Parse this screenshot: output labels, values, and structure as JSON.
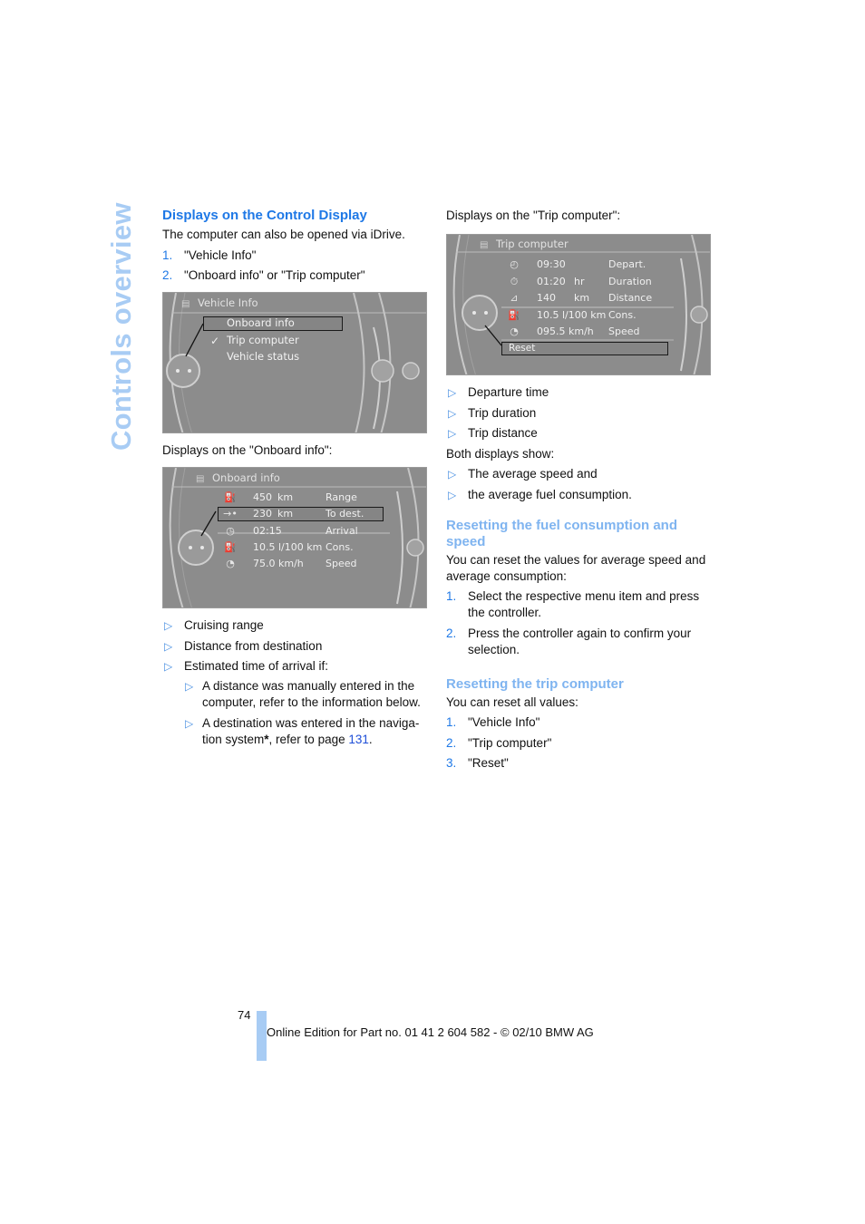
{
  "side_title": "Controls overview",
  "left": {
    "heading": "Displays on the Control Display",
    "intro": "The computer can also be opened via iDrive.",
    "steps": [
      {
        "n": "1.",
        "text": "\"Vehicle Info\""
      },
      {
        "n": "2.",
        "text": "\"Onboard info\" or \"Trip computer\""
      }
    ],
    "screen1": {
      "title": "Vehicle Info",
      "title_icon": "vehicle-icon",
      "menu": [
        {
          "label": "Onboard info",
          "selected": true,
          "checked": false
        },
        {
          "label": "Trip computer",
          "selected": false,
          "checked": true
        },
        {
          "label": "Vehicle status",
          "selected": false,
          "checked": false
        }
      ]
    },
    "onboard_caption": "Displays on the \"Onboard info\":",
    "screen2": {
      "title": "Onboard info",
      "rows": [
        {
          "icon": "fuel-range-icon",
          "glyph": "⛽",
          "value": "450",
          "unit": "km",
          "label": "Range"
        },
        {
          "icon": "destination-arrow-icon",
          "glyph": "→•",
          "value": "230",
          "unit": "km",
          "label": "To dest."
        },
        {
          "icon": "arrival-clock-icon",
          "glyph": "◷",
          "value": "02:15",
          "unit": "",
          "label": "Arrival"
        },
        {
          "icon": "fuel-pump-icon",
          "glyph": "⛽",
          "value": "10.5 l/100 km",
          "unit": "",
          "label": "Cons."
        },
        {
          "icon": "speedometer-icon",
          "glyph": "◔",
          "value": "75.0 km/h",
          "unit": "",
          "label": "Speed"
        }
      ]
    },
    "bullets": [
      "Cruising range",
      "Distance from destination",
      "Estimated time of arrival if:"
    ],
    "sub_bullets": [
      {
        "text": "A distance was manually entered in the computer, refer to the information below."
      },
      {
        "text_before": "A destination was entered in the naviga-tion system",
        "asterisk": "*",
        "text_mid": ", refer to page ",
        "link": "131",
        "text_after": "."
      }
    ]
  },
  "right": {
    "trip_caption": "Displays on the \"Trip computer\":",
    "screen3": {
      "title": "Trip computer",
      "rows": [
        {
          "icon": "departure-clock-icon",
          "glyph": "◴",
          "value": "09:30",
          "unit": "",
          "label": "Depart."
        },
        {
          "icon": "stopwatch-icon",
          "glyph": "⏱",
          "value": "01:20",
          "unit": "hr",
          "label": "Duration"
        },
        {
          "icon": "road-distance-icon",
          "glyph": "⊿",
          "value": "140",
          "unit": "km",
          "label": "Distance"
        },
        {
          "icon": "fuel-pump-icon",
          "glyph": "⛽",
          "value": "10.5 l/100 km",
          "unit": "",
          "label": "Cons."
        },
        {
          "icon": "speedometer-icon",
          "glyph": "◔",
          "value": "095.5 km/h",
          "unit": "",
          "label": "Speed"
        }
      ],
      "reset_label": "Reset"
    },
    "trip_bullets": [
      "Departure time",
      "Trip duration",
      "Trip distance"
    ],
    "both_caption": "Both displays show:",
    "both_bullets": [
      "The average speed and",
      "the average fuel consumption."
    ],
    "reset_fuel": {
      "heading": "Resetting the fuel consumption and speed",
      "intro": "You can reset the values for average speed and average consumption:",
      "steps": [
        {
          "n": "1.",
          "text": "Select the respective menu item and press the controller."
        },
        {
          "n": "2.",
          "text": "Press the controller again to confirm your selection."
        }
      ]
    },
    "reset_trip": {
      "heading": "Resetting the trip computer",
      "intro": "You can reset all values:",
      "steps": [
        {
          "n": "1.",
          "text": "\"Vehicle Info\""
        },
        {
          "n": "2.",
          "text": "\"Trip computer\""
        },
        {
          "n": "3.",
          "text": "\"Reset\""
        }
      ]
    }
  },
  "footer": {
    "page_number": "74",
    "text": "Online Edition for Part no. 01 41 2 604 582 - © 02/10 BMW AG"
  },
  "colors": {
    "heading_blue": "#1e78e6",
    "subheading_blue": "#7fb4f0",
    "side_title": "#a8ccf4",
    "screen_gray": "#8e8e8e"
  }
}
